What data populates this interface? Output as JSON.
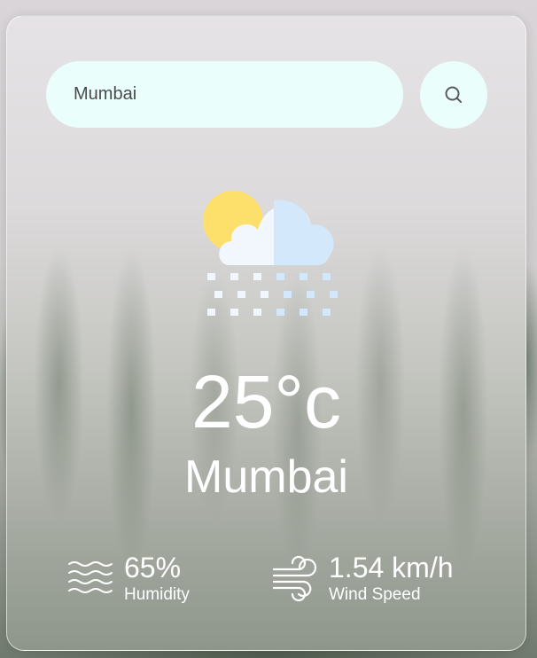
{
  "search": {
    "value": "Mumbai",
    "button_icon": "search-icon"
  },
  "weather": {
    "icon": "rain-cloud-sun-icon",
    "temperature": "25°c",
    "city": "Mumbai"
  },
  "details": {
    "humidity": {
      "icon": "humidity-waves-icon",
      "value": "65%",
      "label": "Humidity"
    },
    "wind": {
      "icon": "wind-icon",
      "value": "1.54 km/h",
      "label": "Wind Speed"
    }
  },
  "colors": {
    "input_background": "#eafefb",
    "text": "#ffffff",
    "sun": "#fde06c",
    "cloud_light": "#f1f7fc",
    "cloud_blue": "#d4e8fb"
  }
}
